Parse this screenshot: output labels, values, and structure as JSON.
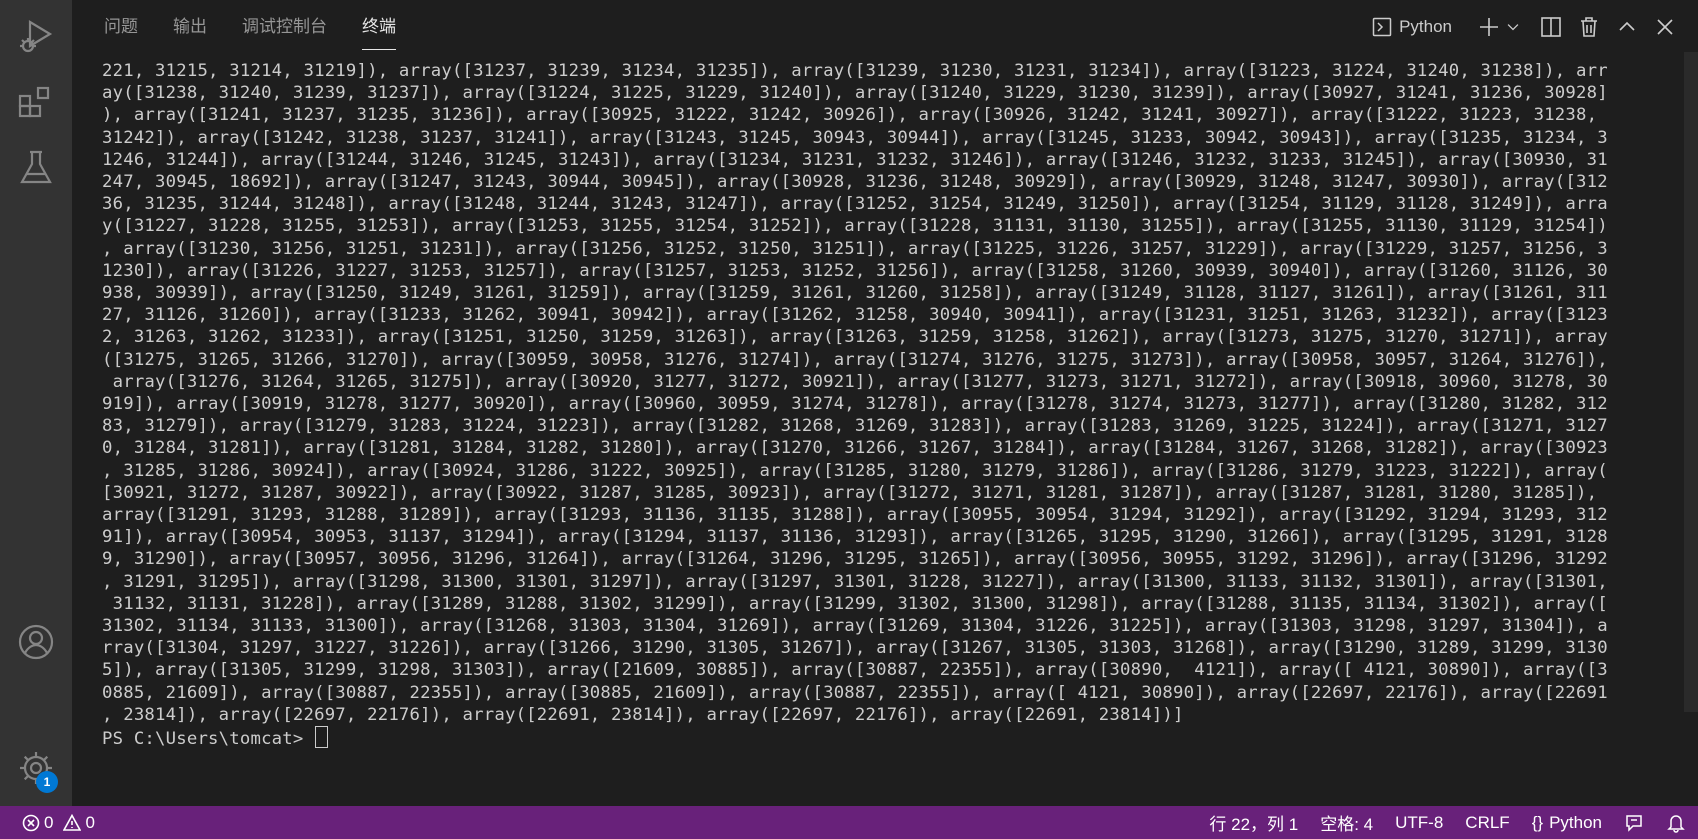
{
  "tabs": [
    {
      "label": "问题",
      "active": false
    },
    {
      "label": "输出",
      "active": false
    },
    {
      "label": "调试控制台",
      "active": false
    },
    {
      "label": "终端",
      "active": true
    }
  ],
  "terminal_profile": "Python",
  "activity": {
    "icons": [
      "run-debug-icon",
      "extensions-icon",
      "testing-icon",
      "account-icon",
      "settings-gear-icon"
    ],
    "settings_badge": "1"
  },
  "terminal_lines": [
    "221, 31215, 31214, 31219]), array([31237, 31239, 31234, 31235]), array([31239, 31230, 31231, 31234]), array([31223, 31224, 31240, 31238]), arr",
    "ay([31238, 31240, 31239, 31237]), array([31224, 31225, 31229, 31240]), array([31240, 31229, 31230, 31239]), array([30927, 31241, 31236, 30928]",
    "), array([31241, 31237, 31235, 31236]), array([30925, 31222, 31242, 30926]), array([30926, 31242, 31241, 30927]), array([31222, 31223, 31238,",
    "31242]), array([31242, 31238, 31237, 31241]), array([31243, 31245, 30943, 30944]), array([31245, 31233, 30942, 30943]), array([31235, 31234, 3",
    "1246, 31244]), array([31244, 31246, 31245, 31243]), array([31234, 31231, 31232, 31246]), array([31246, 31232, 31233, 31245]), array([30930, 31",
    "247, 30945, 18692]), array([31247, 31243, 30944, 30945]), array([30928, 31236, 31248, 30929]), array([30929, 31248, 31247, 30930]), array([312",
    "36, 31235, 31244, 31248]), array([31248, 31244, 31243, 31247]), array([31252, 31254, 31249, 31250]), array([31254, 31129, 31128, 31249]), arra",
    "y([31227, 31228, 31255, 31253]), array([31253, 31255, 31254, 31252]), array([31228, 31131, 31130, 31255]), array([31255, 31130, 31129, 31254])",
    ", array([31230, 31256, 31251, 31231]), array([31256, 31252, 31250, 31251]), array([31225, 31226, 31257, 31229]), array([31229, 31257, 31256, 3",
    "1230]), array([31226, 31227, 31253, 31257]), array([31257, 31253, 31252, 31256]), array([31258, 31260, 30939, 30940]), array([31260, 31126, 30",
    "938, 30939]), array([31250, 31249, 31261, 31259]), array([31259, 31261, 31260, 31258]), array([31249, 31128, 31127, 31261]), array([31261, 311",
    "27, 31126, 31260]), array([31233, 31262, 30941, 30942]), array([31262, 31258, 30940, 30941]), array([31231, 31251, 31263, 31232]), array([3123",
    "2, 31263, 31262, 31233]), array([31251, 31250, 31259, 31263]), array([31263, 31259, 31258, 31262]), array([31273, 31275, 31270, 31271]), array",
    "([31275, 31265, 31266, 31270]), array([30959, 30958, 31276, 31274]), array([31274, 31276, 31275, 31273]), array([30958, 30957, 31264, 31276]),",
    " array([31276, 31264, 31265, 31275]), array([30920, 31277, 31272, 30921]), array([31277, 31273, 31271, 31272]), array([30918, 30960, 31278, 30",
    "919]), array([30919, 31278, 31277, 30920]), array([30960, 30959, 31274, 31278]), array([31278, 31274, 31273, 31277]), array([31280, 31282, 312",
    "83, 31279]), array([31279, 31283, 31224, 31223]), array([31282, 31268, 31269, 31283]), array([31283, 31269, 31225, 31224]), array([31271, 3127",
    "0, 31284, 31281]), array([31281, 31284, 31282, 31280]), array([31270, 31266, 31267, 31284]), array([31284, 31267, 31268, 31282]), array([30923",
    ", 31285, 31286, 30924]), array([30924, 31286, 31222, 30925]), array([31285, 31280, 31279, 31286]), array([31286, 31279, 31223, 31222]), array(",
    "[30921, 31272, 31287, 30922]), array([30922, 31287, 31285, 30923]), array([31272, 31271, 31281, 31287]), array([31287, 31281, 31280, 31285]),",
    "array([31291, 31293, 31288, 31289]), array([31293, 31136, 31135, 31288]), array([30955, 30954, 31294, 31292]), array([31292, 31294, 31293, 312",
    "91]), array([30954, 30953, 31137, 31294]), array([31294, 31137, 31136, 31293]), array([31265, 31295, 31290, 31266]), array([31295, 31291, 3128",
    "9, 31290]), array([30957, 30956, 31296, 31264]), array([31264, 31296, 31295, 31265]), array([30956, 30955, 31292, 31296]), array([31296, 31292",
    ", 31291, 31295]), array([31298, 31300, 31301, 31297]), array([31297, 31301, 31228, 31227]), array([31300, 31133, 31132, 31301]), array([31301,",
    " 31132, 31131, 31228]), array([31289, 31288, 31302, 31299]), array([31299, 31302, 31300, 31298]), array([31288, 31135, 31134, 31302]), array([",
    "31302, 31134, 31133, 31300]), array([31268, 31303, 31304, 31269]), array([31269, 31304, 31226, 31225]), array([31303, 31298, 31297, 31304]), a",
    "rray([31304, 31297, 31227, 31226]), array([31266, 31290, 31305, 31267]), array([31267, 31305, 31303, 31268]), array([31290, 31289, 31299, 3130",
    "5]), array([31305, 31299, 31298, 31303]), array([21609, 30885]), array([30887, 22355]), array([30890,  4121]), array([ 4121, 30890]), array([3",
    "0885, 21609]), array([30887, 22355]), array([30885, 21609]), array([30887, 22355]), array([ 4121, 30890]), array([22697, 22176]), array([22691",
    ", 23814]), array([22697, 22176]), array([22691, 23814]), array([22697, 22176]), array([22691, 23814])]"
  ],
  "prompt": "PS C:\\Users\\tomcat> ",
  "status": {
    "errors": "0",
    "warnings": "0",
    "position": "行 22，列 1",
    "spaces": "空格: 4",
    "encoding": "UTF-8",
    "eol": "CRLF",
    "language": "Python"
  }
}
